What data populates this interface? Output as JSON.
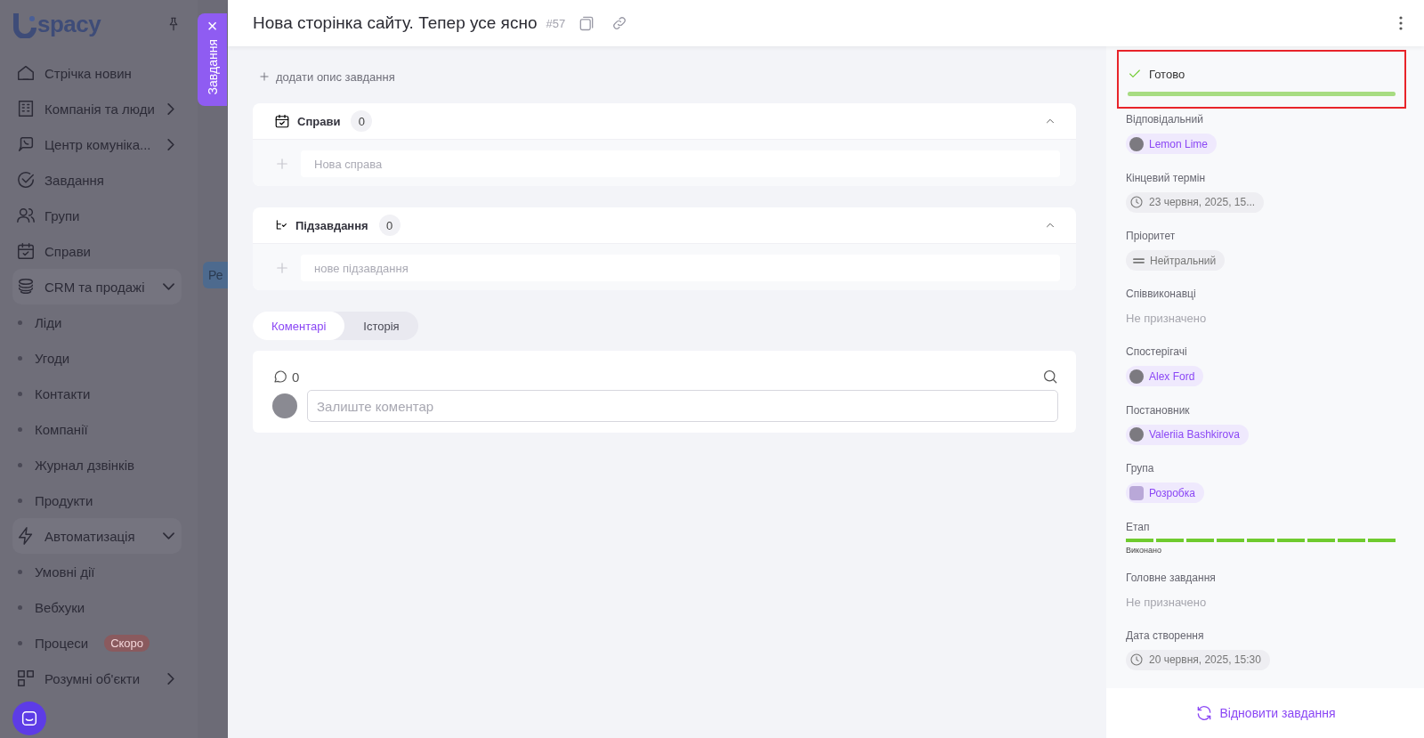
{
  "sidebar": {
    "logo": "spacy",
    "items": [
      {
        "label": "Стрічка новин",
        "kind": "home"
      },
      {
        "label": "Компанія та люди",
        "kind": "building",
        "expanded": false
      },
      {
        "label": "Центр комуніка...",
        "kind": "chat",
        "expanded": false
      },
      {
        "label": "Завдання",
        "kind": "check"
      },
      {
        "label": "Групи",
        "kind": "people"
      },
      {
        "label": "Справи",
        "kind": "calendar"
      },
      {
        "label": "CRM та продажі",
        "kind": "coins",
        "expanded": true,
        "children": [
          {
            "label": "Ліди"
          },
          {
            "label": "Угоди"
          },
          {
            "label": "Контакти"
          },
          {
            "label": "Компанії"
          },
          {
            "label": "Журнал дзвінків"
          },
          {
            "label": "Продукти"
          }
        ]
      },
      {
        "label": "Автоматизація",
        "kind": "bolt",
        "expanded": true,
        "children": [
          {
            "label": "Умовні дії"
          },
          {
            "label": "Вебхуки"
          },
          {
            "label": "Процеси",
            "badge": "Скоро"
          }
        ]
      },
      {
        "label": "Розумні об'єкти",
        "kind": "grid",
        "expanded": false
      }
    ]
  },
  "background_button": "Ре",
  "panel_tab": {
    "label": "Завдання",
    "close": "×"
  },
  "header": {
    "title": "Нова сторінка сайту. Тепер усе ясно",
    "number": "#57"
  },
  "add_description": "додати опис завдання",
  "sections": [
    {
      "kind": "activities",
      "title": "Справи",
      "count": "0",
      "expanded": true,
      "placeholder": "Нова справа"
    },
    {
      "kind": "subtasks",
      "title": "Підзавдання",
      "count": "0",
      "expanded": true,
      "placeholder": "нове підзавдання"
    }
  ],
  "tabs": [
    {
      "label": "Коментарі",
      "selected": true
    },
    {
      "label": "Історія",
      "selected": false
    }
  ],
  "comments": {
    "count": "0",
    "placeholder": "Залиште коментар"
  },
  "status": {
    "label": "Готово",
    "level": 1,
    "highlighted": true
  },
  "fields": [
    {
      "kind": "person",
      "label": "Відповідальний",
      "value": "Lemon Lime"
    },
    {
      "kind": "date",
      "label": "Кінцевий термін",
      "value": "23 червня, 2025, 15..."
    },
    {
      "kind": "priority",
      "label": "Пріоритет",
      "value": "Нейтральний"
    },
    {
      "kind": "empty",
      "label": "Співвиконавці",
      "value": "Не призначено"
    },
    {
      "kind": "person",
      "label": "Спостерігачі",
      "value": "Alex Ford"
    },
    {
      "kind": "person",
      "label": "Постановник",
      "value": "Valeriia Bashkirova"
    },
    {
      "kind": "group",
      "label": "Група",
      "value": "Розробка"
    },
    {
      "kind": "stage",
      "label": "Етап",
      "value": "Виконано",
      "level": 1
    },
    {
      "kind": "empty",
      "label": "Головне завдання",
      "value": "Не призначено"
    },
    {
      "kind": "date",
      "label": "Дата створення",
      "value": "20 червня, 2025, 15:30"
    }
  ],
  "restore_button": "Відновити завдання"
}
